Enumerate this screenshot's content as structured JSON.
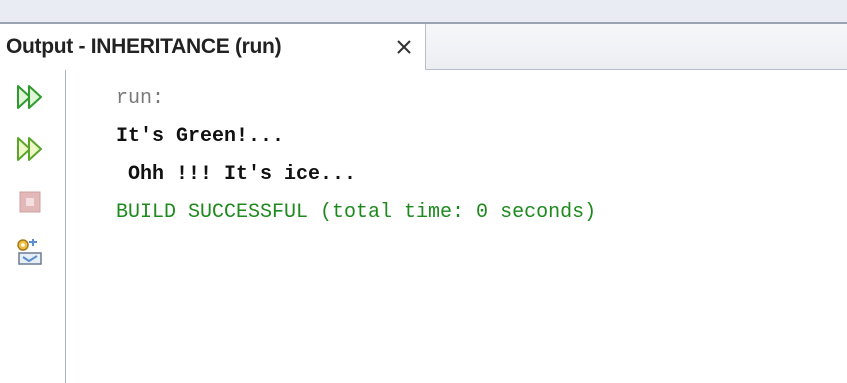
{
  "top_strip": {},
  "output_window": {
    "tab": {
      "title": "Output - INHERITANCE (run)",
      "close_glyph": "✕"
    },
    "toolbar": {
      "buttons": [
        {
          "name": "rerun-icon",
          "color": "#2e9b2e"
        },
        {
          "name": "rerun-with-options-icon",
          "color": "#2e9b2e"
        },
        {
          "name": "stop-icon",
          "color": "#d9a0a0"
        },
        {
          "name": "settings-icon",
          "color": "#5a8fcf"
        }
      ]
    },
    "console": {
      "lines": [
        {
          "text": "run:",
          "color": "#7a7a7a"
        },
        {
          "text": "It's Green!...",
          "color": "#111111"
        },
        {
          "text": " Ohh !!! It's ice...",
          "color": "#111111"
        },
        {
          "text": "BUILD SUCCESSFUL (total time: 0 seconds)",
          "color": "#1e8a1e"
        }
      ]
    }
  }
}
